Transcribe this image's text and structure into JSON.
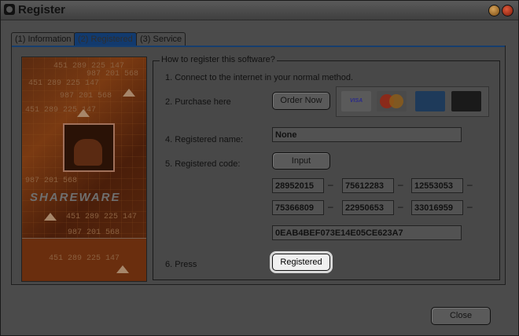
{
  "window": {
    "title": "Register"
  },
  "tabs": [
    {
      "label": "(1) Information"
    },
    {
      "label": "(2) Registered"
    },
    {
      "label": "(3) Service"
    }
  ],
  "image_panel": {
    "banner_text": "SHAREWARE",
    "numbers": [
      "451 289 225 147",
      "987 201 568",
      "451 289 225 147",
      "987 201 568",
      "451 289 225 147",
      "987 201 568",
      "451 289 225 147",
      "987 201 568",
      "451 289 225 147"
    ]
  },
  "group": {
    "legend": "How to register this software?",
    "step1": "1. Connect to the internet in your normal method.",
    "step2": "2. Purchase here",
    "order_button": "Order Now",
    "cards": [
      {
        "name": "VISA",
        "icon": "visa-card-icon"
      },
      {
        "name": "MasterCard",
        "icon": "mastercard-icon"
      },
      {
        "name": "AMERICAN EXPRESS",
        "icon": "amex-card-icon"
      },
      {
        "name": "JCB",
        "icon": "jcb-card-icon"
      }
    ],
    "step4": "4. Registered name:",
    "registered_name": "None",
    "step5": "5. Registered code:",
    "input_button": "Input",
    "code_row1": [
      "28952015",
      "75612283",
      "12553053"
    ],
    "code_row2": [
      "75366809",
      "22950653",
      "33016959"
    ],
    "dash": "–",
    "hash": "0EAB4BEF073E14E05CE623A7",
    "step6": "6. Press",
    "registered_button": "Registered"
  },
  "footer": {
    "close_button": "Close"
  }
}
